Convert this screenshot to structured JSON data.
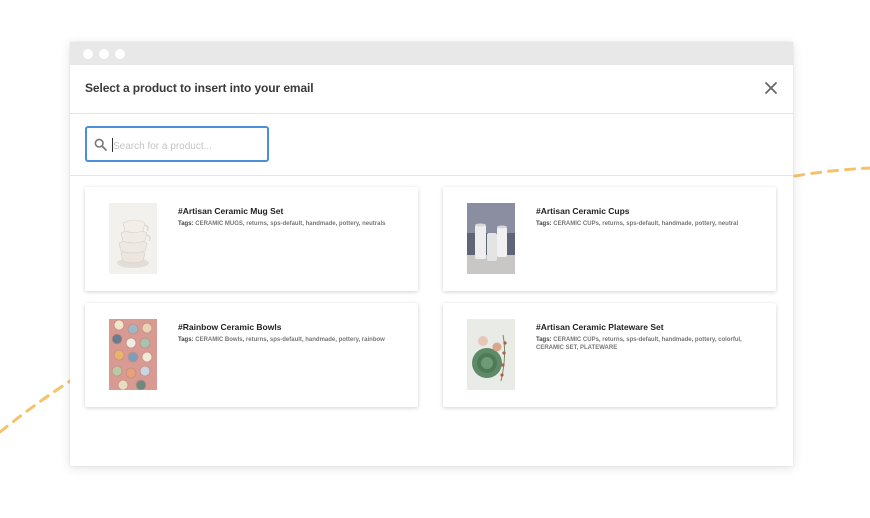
{
  "modal": {
    "title": "Select a product to insert into your email"
  },
  "search": {
    "placeholder": "Search for a product...",
    "value": ""
  },
  "tags_label": "Tags:",
  "products": [
    {
      "title": "#Artisan Ceramic Mug Set",
      "tags": "CERAMIC MUGS, returns, sps-default, handmade, pottery, neutrals",
      "image": "stacked-mugs"
    },
    {
      "title": "#Artisan Ceramic Cups",
      "tags": "CERAMIC CUPs, returns, sps-default, handmade, pottery, neutral",
      "image": "white-cups"
    },
    {
      "title": "#Rainbow Ceramic Bowls",
      "tags": "CERAMIC Bowls, returns, sps-default, handmade, pottery, rainbow",
      "image": "colorful-bowls"
    },
    {
      "title": "#Artisan Ceramic Plateware Set",
      "tags": "CERAMIC CUPs, returns, sps-default, handmade, pottery, colorful, CERAMIC SET, PLATEWARE",
      "image": "green-plates"
    }
  ],
  "colors": {
    "accent": "#4a90d9",
    "decoration": "#f5c26b"
  }
}
